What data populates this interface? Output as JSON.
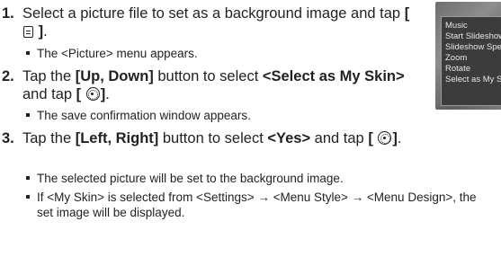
{
  "steps": [
    {
      "number": "1.",
      "parts": [
        {
          "text": "Select a picture file to set as a background image and tap ",
          "bold": false
        },
        {
          "text": "[ ",
          "bold": true
        },
        {
          "icon": "menu-icon"
        },
        {
          "text": " ]",
          "bold": true
        },
        {
          "text": ".",
          "bold": false
        }
      ],
      "bullets": [
        "The <Picture> menu appears."
      ]
    },
    {
      "number": "2.",
      "parts": [
        {
          "text": "Tap the ",
          "bold": false
        },
        {
          "text": "[Up, Down]",
          "bold": true
        },
        {
          "text": " button to select ",
          "bold": false
        },
        {
          "text": "<Select as My Skin>",
          "bold": true
        },
        {
          "text": " and tap ",
          "bold": false
        },
        {
          "text": "[ ",
          "bold": true
        },
        {
          "icon": "select-icon"
        },
        {
          "text": "]",
          "bold": true
        },
        {
          "text": ".",
          "bold": false
        }
      ],
      "bullets": [
        "The save confirmation window appears."
      ]
    },
    {
      "number": "3.",
      "parts": [
        {
          "text": "Tap the ",
          "bold": false
        },
        {
          "text": "[Left, Right]",
          "bold": true
        },
        {
          "text": " button to select ",
          "bold": false
        },
        {
          "text": "<Yes>",
          "bold": true
        },
        {
          "text": " and tap ",
          "bold": false
        },
        {
          "text": "[ ",
          "bold": true
        },
        {
          "icon": "select-icon"
        },
        {
          "text": "]",
          "bold": true
        },
        {
          "text": ".",
          "bold": false
        }
      ],
      "bullets": [
        "The selected picture will be set to the background image.",
        "If <My Skin> is selected from <Settings> → <Menu Style> → <Menu Design>, the set image will be displayed."
      ]
    }
  ],
  "device_menu": {
    "items": [
      "Music",
      "Start Slideshow",
      "Slideshow Speed",
      "Zoom",
      "Rotate",
      "Select as My Skin"
    ],
    "selected_index": 5
  }
}
